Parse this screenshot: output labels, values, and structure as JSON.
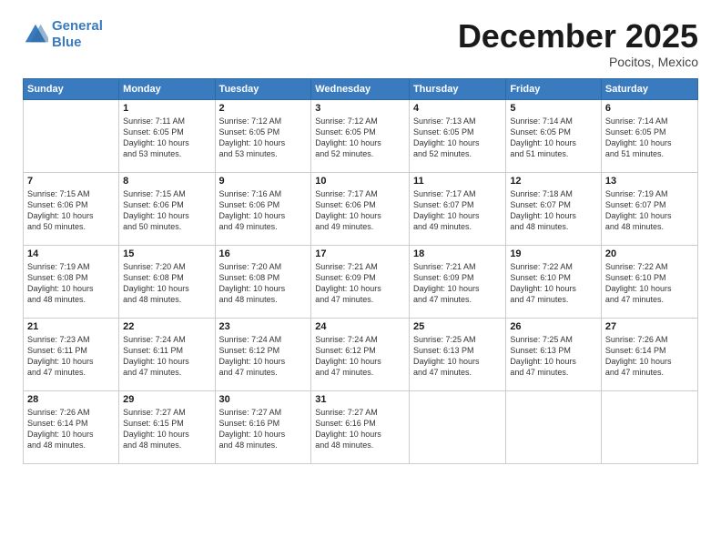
{
  "logo": {
    "line1": "General",
    "line2": "Blue"
  },
  "title": "December 2025",
  "location": "Pocitos, Mexico",
  "days_header": [
    "Sunday",
    "Monday",
    "Tuesday",
    "Wednesday",
    "Thursday",
    "Friday",
    "Saturday"
  ],
  "weeks": [
    [
      {
        "num": "",
        "info": ""
      },
      {
        "num": "1",
        "info": "Sunrise: 7:11 AM\nSunset: 6:05 PM\nDaylight: 10 hours\nand 53 minutes."
      },
      {
        "num": "2",
        "info": "Sunrise: 7:12 AM\nSunset: 6:05 PM\nDaylight: 10 hours\nand 53 minutes."
      },
      {
        "num": "3",
        "info": "Sunrise: 7:12 AM\nSunset: 6:05 PM\nDaylight: 10 hours\nand 52 minutes."
      },
      {
        "num": "4",
        "info": "Sunrise: 7:13 AM\nSunset: 6:05 PM\nDaylight: 10 hours\nand 52 minutes."
      },
      {
        "num": "5",
        "info": "Sunrise: 7:14 AM\nSunset: 6:05 PM\nDaylight: 10 hours\nand 51 minutes."
      },
      {
        "num": "6",
        "info": "Sunrise: 7:14 AM\nSunset: 6:05 PM\nDaylight: 10 hours\nand 51 minutes."
      }
    ],
    [
      {
        "num": "7",
        "info": "Sunrise: 7:15 AM\nSunset: 6:06 PM\nDaylight: 10 hours\nand 50 minutes."
      },
      {
        "num": "8",
        "info": "Sunrise: 7:15 AM\nSunset: 6:06 PM\nDaylight: 10 hours\nand 50 minutes."
      },
      {
        "num": "9",
        "info": "Sunrise: 7:16 AM\nSunset: 6:06 PM\nDaylight: 10 hours\nand 49 minutes."
      },
      {
        "num": "10",
        "info": "Sunrise: 7:17 AM\nSunset: 6:06 PM\nDaylight: 10 hours\nand 49 minutes."
      },
      {
        "num": "11",
        "info": "Sunrise: 7:17 AM\nSunset: 6:07 PM\nDaylight: 10 hours\nand 49 minutes."
      },
      {
        "num": "12",
        "info": "Sunrise: 7:18 AM\nSunset: 6:07 PM\nDaylight: 10 hours\nand 48 minutes."
      },
      {
        "num": "13",
        "info": "Sunrise: 7:19 AM\nSunset: 6:07 PM\nDaylight: 10 hours\nand 48 minutes."
      }
    ],
    [
      {
        "num": "14",
        "info": "Sunrise: 7:19 AM\nSunset: 6:08 PM\nDaylight: 10 hours\nand 48 minutes."
      },
      {
        "num": "15",
        "info": "Sunrise: 7:20 AM\nSunset: 6:08 PM\nDaylight: 10 hours\nand 48 minutes."
      },
      {
        "num": "16",
        "info": "Sunrise: 7:20 AM\nSunset: 6:08 PM\nDaylight: 10 hours\nand 48 minutes."
      },
      {
        "num": "17",
        "info": "Sunrise: 7:21 AM\nSunset: 6:09 PM\nDaylight: 10 hours\nand 47 minutes."
      },
      {
        "num": "18",
        "info": "Sunrise: 7:21 AM\nSunset: 6:09 PM\nDaylight: 10 hours\nand 47 minutes."
      },
      {
        "num": "19",
        "info": "Sunrise: 7:22 AM\nSunset: 6:10 PM\nDaylight: 10 hours\nand 47 minutes."
      },
      {
        "num": "20",
        "info": "Sunrise: 7:22 AM\nSunset: 6:10 PM\nDaylight: 10 hours\nand 47 minutes."
      }
    ],
    [
      {
        "num": "21",
        "info": "Sunrise: 7:23 AM\nSunset: 6:11 PM\nDaylight: 10 hours\nand 47 minutes."
      },
      {
        "num": "22",
        "info": "Sunrise: 7:24 AM\nSunset: 6:11 PM\nDaylight: 10 hours\nand 47 minutes."
      },
      {
        "num": "23",
        "info": "Sunrise: 7:24 AM\nSunset: 6:12 PM\nDaylight: 10 hours\nand 47 minutes."
      },
      {
        "num": "24",
        "info": "Sunrise: 7:24 AM\nSunset: 6:12 PM\nDaylight: 10 hours\nand 47 minutes."
      },
      {
        "num": "25",
        "info": "Sunrise: 7:25 AM\nSunset: 6:13 PM\nDaylight: 10 hours\nand 47 minutes."
      },
      {
        "num": "26",
        "info": "Sunrise: 7:25 AM\nSunset: 6:13 PM\nDaylight: 10 hours\nand 47 minutes."
      },
      {
        "num": "27",
        "info": "Sunrise: 7:26 AM\nSunset: 6:14 PM\nDaylight: 10 hours\nand 47 minutes."
      }
    ],
    [
      {
        "num": "28",
        "info": "Sunrise: 7:26 AM\nSunset: 6:14 PM\nDaylight: 10 hours\nand 48 minutes."
      },
      {
        "num": "29",
        "info": "Sunrise: 7:27 AM\nSunset: 6:15 PM\nDaylight: 10 hours\nand 48 minutes."
      },
      {
        "num": "30",
        "info": "Sunrise: 7:27 AM\nSunset: 6:16 PM\nDaylight: 10 hours\nand 48 minutes."
      },
      {
        "num": "31",
        "info": "Sunrise: 7:27 AM\nSunset: 6:16 PM\nDaylight: 10 hours\nand 48 minutes."
      },
      {
        "num": "",
        "info": ""
      },
      {
        "num": "",
        "info": ""
      },
      {
        "num": "",
        "info": ""
      }
    ]
  ]
}
